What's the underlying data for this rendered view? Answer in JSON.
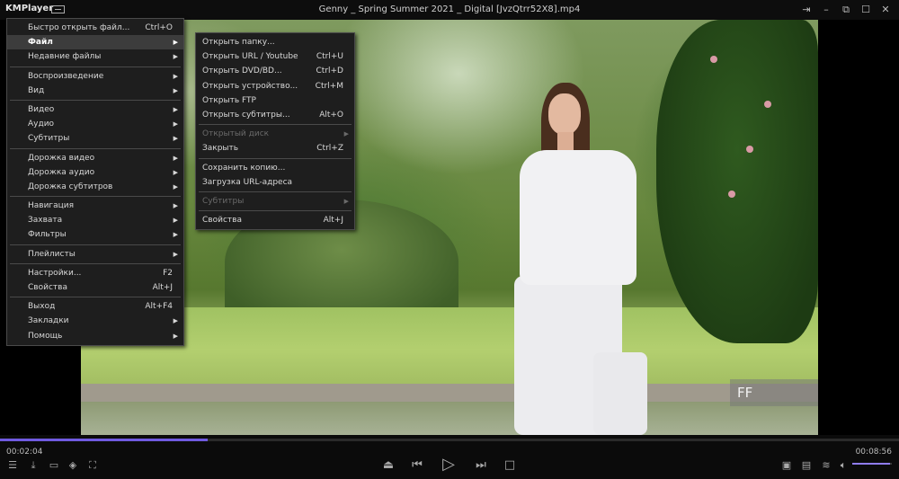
{
  "app": {
    "name": "KMPlayer",
    "window_title": "Genny _ Spring Summer 2021 _ Digital [JvzQtrr52X8].mp4"
  },
  "titlebar_icons": [
    "pin-icon",
    "minimize-icon",
    "restore-icon",
    "maximize-icon",
    "close-icon"
  ],
  "main_menu": {
    "items": [
      {
        "label": "Быстро открыть файл...",
        "shortcut": "Ctrl+O",
        "submenu": false
      },
      {
        "label": "Файл",
        "shortcut": "",
        "submenu": true,
        "active": true
      },
      {
        "label": "Недавние файлы",
        "shortcut": "",
        "submenu": true
      },
      {
        "label": "Воспроизведение",
        "shortcut": "",
        "submenu": true
      },
      {
        "label": "Вид",
        "shortcut": "",
        "submenu": true
      },
      {
        "label": "Видео",
        "shortcut": "",
        "submenu": true
      },
      {
        "label": "Аудио",
        "shortcut": "",
        "submenu": true
      },
      {
        "label": "Субтитры",
        "shortcut": "",
        "submenu": true
      },
      {
        "label": "Дорожка видео",
        "shortcut": "",
        "submenu": true
      },
      {
        "label": "Дорожка аудио",
        "shortcut": "",
        "submenu": true
      },
      {
        "label": "Дорожка субтитров",
        "shortcut": "",
        "submenu": true
      },
      {
        "label": "Навигация",
        "shortcut": "",
        "submenu": true
      },
      {
        "label": "Захвата",
        "shortcut": "",
        "submenu": true
      },
      {
        "label": "Фильтры",
        "shortcut": "",
        "submenu": true
      },
      {
        "label": "Плейлисты",
        "shortcut": "",
        "submenu": true
      },
      {
        "label": "Настройки...",
        "shortcut": "F2",
        "submenu": false
      },
      {
        "label": "Свойства",
        "shortcut": "Alt+J",
        "submenu": false
      },
      {
        "label": "Выход",
        "shortcut": "Alt+F4",
        "submenu": false
      },
      {
        "label": "Закладки",
        "shortcut": "",
        "submenu": true
      },
      {
        "label": "Помощь",
        "shortcut": "",
        "submenu": true
      }
    ]
  },
  "file_submenu": {
    "items": [
      {
        "label": "Открыть папку...",
        "shortcut": "",
        "submenu": false,
        "disabled": false
      },
      {
        "label": "Открыть URL / Youtube",
        "shortcut": "Ctrl+U",
        "submenu": false,
        "disabled": false
      },
      {
        "label": "Открыть DVD/BD...",
        "shortcut": "Ctrl+D",
        "submenu": false,
        "disabled": false
      },
      {
        "label": "Открыть устройство...",
        "shortcut": "Ctrl+M",
        "submenu": false,
        "disabled": false
      },
      {
        "label": "Открыть FTP",
        "shortcut": "",
        "submenu": false,
        "disabled": false
      },
      {
        "label": "Открыть субтитры...",
        "shortcut": "Alt+O",
        "submenu": false,
        "disabled": false
      },
      {
        "label": "Открытый диск",
        "shortcut": "",
        "submenu": true,
        "disabled": true
      },
      {
        "label": "Закрыть",
        "shortcut": "Ctrl+Z",
        "submenu": false,
        "disabled": false
      },
      {
        "label": "Сохранить копию...",
        "shortcut": "",
        "submenu": false,
        "disabled": false
      },
      {
        "label": "Загрузка URL-адреса",
        "shortcut": "",
        "submenu": false,
        "disabled": false
      },
      {
        "label": "Субтитры",
        "shortcut": "",
        "submenu": true,
        "disabled": true
      },
      {
        "label": "Свойства",
        "shortcut": "Alt+J",
        "submenu": false,
        "disabled": false
      }
    ]
  },
  "video_overlay": {
    "badge": "FF"
  },
  "playback": {
    "current_time": "00:02:04",
    "total_time": "00:08:56",
    "progress": 0.2313,
    "volume": 0.95
  },
  "controls": {
    "left_icons": [
      "playlist-icon",
      "download-icon",
      "vr-icon",
      "3d-icon",
      "capture-icon"
    ],
    "center_icons": [
      "eject-icon",
      "previous-icon",
      "play-icon",
      "next-icon",
      "stop-icon"
    ],
    "right_icons": [
      "hw-decoder-icon",
      "subtitle-icon",
      "equalizer-icon",
      "volume-icon"
    ]
  },
  "colors": {
    "accent": "#6f5ae0",
    "menu_bg": "#1e1e1e",
    "menu_highlight": "#3c3c3c"
  }
}
